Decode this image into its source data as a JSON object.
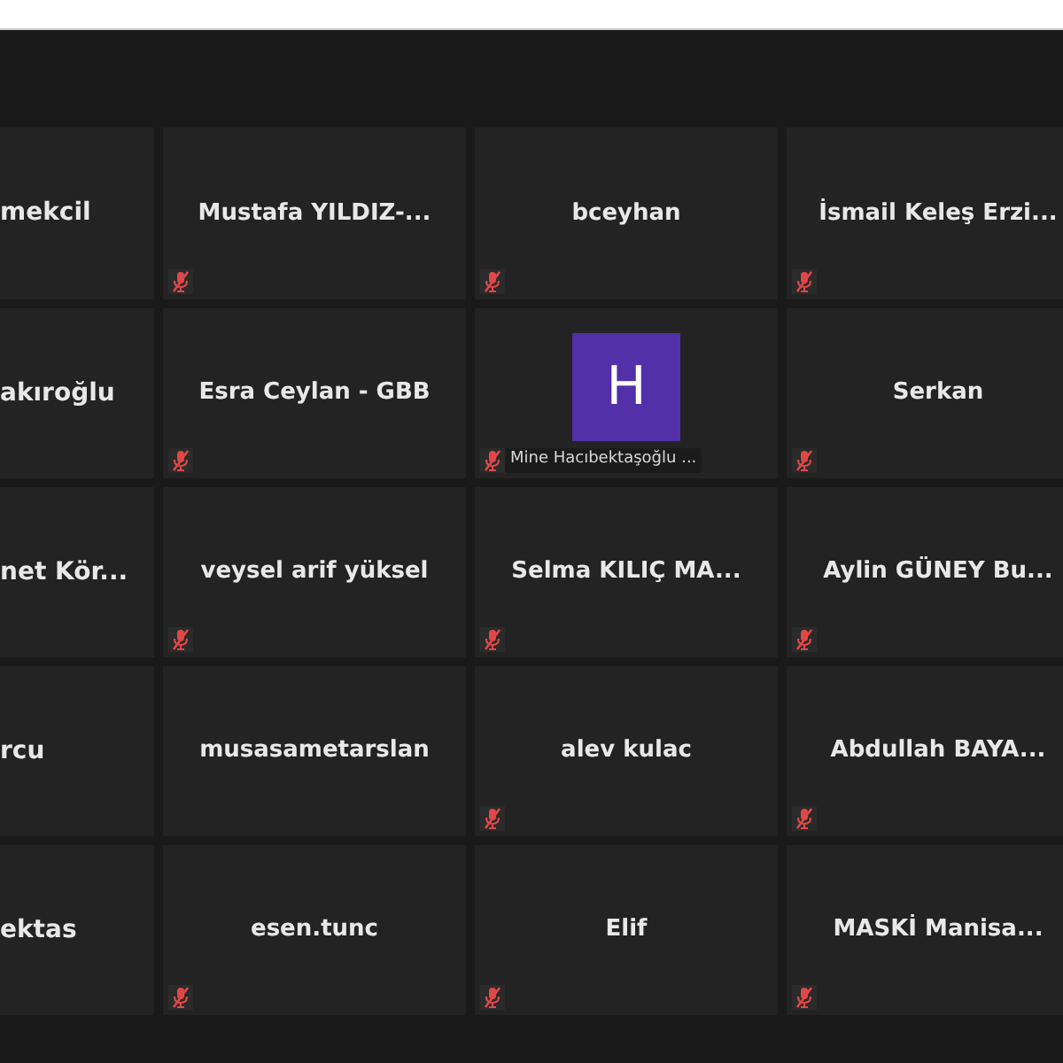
{
  "tiles": [
    {
      "name": "mekcil",
      "kind": "partial",
      "muted": false
    },
    {
      "name": "Mustafa YILDIZ-...",
      "kind": "name",
      "muted": true
    },
    {
      "name": "bceyhan",
      "kind": "name",
      "muted": true
    },
    {
      "name": "İsmail Keleş Erzi...",
      "kind": "name",
      "muted": true
    },
    {
      "name": "akıroğlu",
      "kind": "partial",
      "muted": false
    },
    {
      "name": "Esra Ceylan - GBB",
      "kind": "name",
      "muted": true
    },
    {
      "name": "Mine Hacıbektaşoğlu ...",
      "kind": "avatar",
      "initial": "H",
      "muted": true
    },
    {
      "name": "Serkan",
      "kind": "name",
      "muted": true
    },
    {
      "name": "net Kör...",
      "kind": "partial",
      "muted": false
    },
    {
      "name": "veysel arif yüksel",
      "kind": "name",
      "muted": true
    },
    {
      "name": "Selma KILIÇ MA...",
      "kind": "name",
      "muted": true
    },
    {
      "name": "Aylin GÜNEY Bu...",
      "kind": "name",
      "muted": true
    },
    {
      "name": "rcu",
      "kind": "partial",
      "muted": false
    },
    {
      "name": "musasametarslan",
      "kind": "name",
      "muted": false
    },
    {
      "name": "alev kulac",
      "kind": "name",
      "muted": true
    },
    {
      "name": "Abdullah BAYA...",
      "kind": "name",
      "muted": true
    },
    {
      "name": "ektas",
      "kind": "partial",
      "muted": false
    },
    {
      "name": "esen.tunc",
      "kind": "name",
      "muted": true
    },
    {
      "name": "Elif",
      "kind": "name",
      "muted": true
    },
    {
      "name": "MASKİ Manisa...",
      "kind": "name",
      "muted": true
    }
  ]
}
